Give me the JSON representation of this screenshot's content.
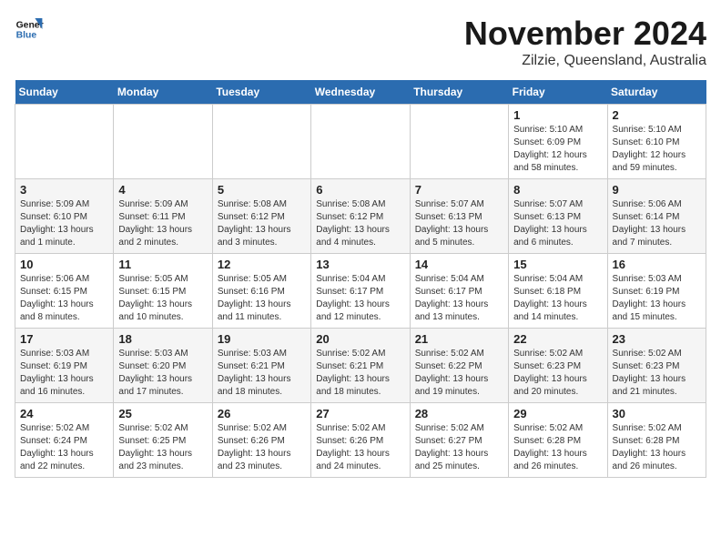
{
  "header": {
    "logo_line1": "General",
    "logo_line2": "Blue",
    "month": "November 2024",
    "location": "Zilzie, Queensland, Australia"
  },
  "weekdays": [
    "Sunday",
    "Monday",
    "Tuesday",
    "Wednesday",
    "Thursday",
    "Friday",
    "Saturday"
  ],
  "weeks": [
    [
      {
        "day": "",
        "info": ""
      },
      {
        "day": "",
        "info": ""
      },
      {
        "day": "",
        "info": ""
      },
      {
        "day": "",
        "info": ""
      },
      {
        "day": "",
        "info": ""
      },
      {
        "day": "1",
        "info": "Sunrise: 5:10 AM\nSunset: 6:09 PM\nDaylight: 12 hours\nand 58 minutes."
      },
      {
        "day": "2",
        "info": "Sunrise: 5:10 AM\nSunset: 6:10 PM\nDaylight: 12 hours\nand 59 minutes."
      }
    ],
    [
      {
        "day": "3",
        "info": "Sunrise: 5:09 AM\nSunset: 6:10 PM\nDaylight: 13 hours\nand 1 minute."
      },
      {
        "day": "4",
        "info": "Sunrise: 5:09 AM\nSunset: 6:11 PM\nDaylight: 13 hours\nand 2 minutes."
      },
      {
        "day": "5",
        "info": "Sunrise: 5:08 AM\nSunset: 6:12 PM\nDaylight: 13 hours\nand 3 minutes."
      },
      {
        "day": "6",
        "info": "Sunrise: 5:08 AM\nSunset: 6:12 PM\nDaylight: 13 hours\nand 4 minutes."
      },
      {
        "day": "7",
        "info": "Sunrise: 5:07 AM\nSunset: 6:13 PM\nDaylight: 13 hours\nand 5 minutes."
      },
      {
        "day": "8",
        "info": "Sunrise: 5:07 AM\nSunset: 6:13 PM\nDaylight: 13 hours\nand 6 minutes."
      },
      {
        "day": "9",
        "info": "Sunrise: 5:06 AM\nSunset: 6:14 PM\nDaylight: 13 hours\nand 7 minutes."
      }
    ],
    [
      {
        "day": "10",
        "info": "Sunrise: 5:06 AM\nSunset: 6:15 PM\nDaylight: 13 hours\nand 8 minutes."
      },
      {
        "day": "11",
        "info": "Sunrise: 5:05 AM\nSunset: 6:15 PM\nDaylight: 13 hours\nand 10 minutes."
      },
      {
        "day": "12",
        "info": "Sunrise: 5:05 AM\nSunset: 6:16 PM\nDaylight: 13 hours\nand 11 minutes."
      },
      {
        "day": "13",
        "info": "Sunrise: 5:04 AM\nSunset: 6:17 PM\nDaylight: 13 hours\nand 12 minutes."
      },
      {
        "day": "14",
        "info": "Sunrise: 5:04 AM\nSunset: 6:17 PM\nDaylight: 13 hours\nand 13 minutes."
      },
      {
        "day": "15",
        "info": "Sunrise: 5:04 AM\nSunset: 6:18 PM\nDaylight: 13 hours\nand 14 minutes."
      },
      {
        "day": "16",
        "info": "Sunrise: 5:03 AM\nSunset: 6:19 PM\nDaylight: 13 hours\nand 15 minutes."
      }
    ],
    [
      {
        "day": "17",
        "info": "Sunrise: 5:03 AM\nSunset: 6:19 PM\nDaylight: 13 hours\nand 16 minutes."
      },
      {
        "day": "18",
        "info": "Sunrise: 5:03 AM\nSunset: 6:20 PM\nDaylight: 13 hours\nand 17 minutes."
      },
      {
        "day": "19",
        "info": "Sunrise: 5:03 AM\nSunset: 6:21 PM\nDaylight: 13 hours\nand 18 minutes."
      },
      {
        "day": "20",
        "info": "Sunrise: 5:02 AM\nSunset: 6:21 PM\nDaylight: 13 hours\nand 18 minutes."
      },
      {
        "day": "21",
        "info": "Sunrise: 5:02 AM\nSunset: 6:22 PM\nDaylight: 13 hours\nand 19 minutes."
      },
      {
        "day": "22",
        "info": "Sunrise: 5:02 AM\nSunset: 6:23 PM\nDaylight: 13 hours\nand 20 minutes."
      },
      {
        "day": "23",
        "info": "Sunrise: 5:02 AM\nSunset: 6:23 PM\nDaylight: 13 hours\nand 21 minutes."
      }
    ],
    [
      {
        "day": "24",
        "info": "Sunrise: 5:02 AM\nSunset: 6:24 PM\nDaylight: 13 hours\nand 22 minutes."
      },
      {
        "day": "25",
        "info": "Sunrise: 5:02 AM\nSunset: 6:25 PM\nDaylight: 13 hours\nand 23 minutes."
      },
      {
        "day": "26",
        "info": "Sunrise: 5:02 AM\nSunset: 6:26 PM\nDaylight: 13 hours\nand 23 minutes."
      },
      {
        "day": "27",
        "info": "Sunrise: 5:02 AM\nSunset: 6:26 PM\nDaylight: 13 hours\nand 24 minutes."
      },
      {
        "day": "28",
        "info": "Sunrise: 5:02 AM\nSunset: 6:27 PM\nDaylight: 13 hours\nand 25 minutes."
      },
      {
        "day": "29",
        "info": "Sunrise: 5:02 AM\nSunset: 6:28 PM\nDaylight: 13 hours\nand 26 minutes."
      },
      {
        "day": "30",
        "info": "Sunrise: 5:02 AM\nSunset: 6:28 PM\nDaylight: 13 hours\nand 26 minutes."
      }
    ]
  ]
}
